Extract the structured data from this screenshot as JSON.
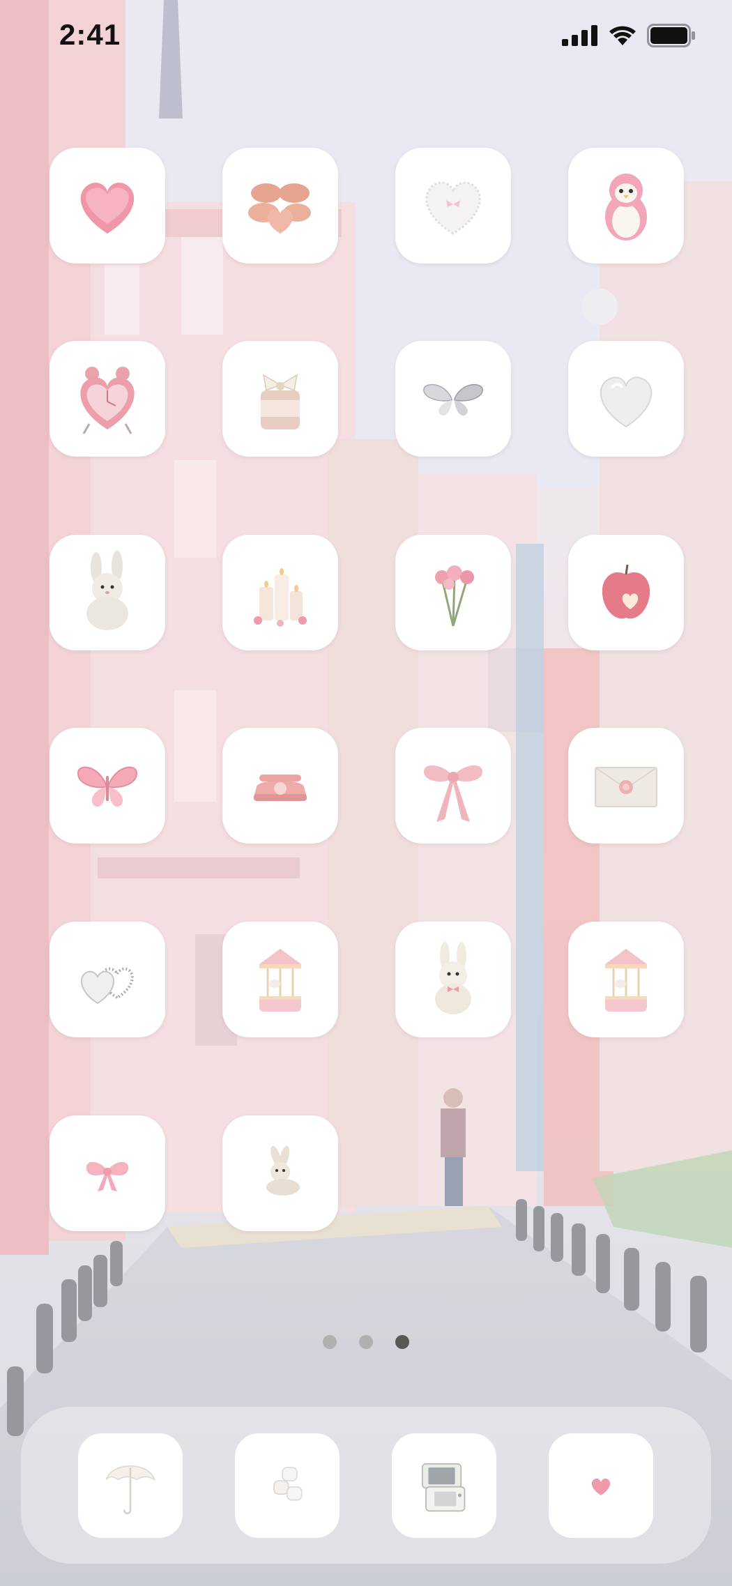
{
  "status_bar": {
    "time": "2:41",
    "icons": [
      "cellular-signal-icon",
      "wifi-icon",
      "battery-icon"
    ]
  },
  "home_screen": {
    "page_count": 3,
    "current_page": 3,
    "apps": [
      {
        "icon": "pink-heart-sponge-icon"
      },
      {
        "icon": "heart-macarons-icon"
      },
      {
        "icon": "white-lace-heart-icon"
      },
      {
        "icon": "pink-penguin-plush-icon"
      },
      {
        "icon": "heart-alarm-clock-icon"
      },
      {
        "icon": "bow-candle-jar-icon"
      },
      {
        "icon": "silver-butterfly-icon"
      },
      {
        "icon": "white-heart-icon"
      },
      {
        "icon": "bunny-plush-icon"
      },
      {
        "icon": "candles-roses-icon"
      },
      {
        "icon": "pink-roses-bouquet-icon"
      },
      {
        "icon": "apple-heart-icon"
      },
      {
        "icon": "pink-butterfly-icon"
      },
      {
        "icon": "pink-rotary-phone-icon"
      },
      {
        "icon": "pink-ribbon-bow-icon"
      },
      {
        "icon": "wax-seal-envelope-icon"
      },
      {
        "icon": "double-heart-charm-icon"
      },
      {
        "icon": "carousel-music-box-icon"
      },
      {
        "icon": "bunny-with-bow-icon"
      },
      {
        "icon": "carousel-music-box-icon"
      },
      {
        "icon": "small-pink-bow-icon"
      },
      {
        "icon": "lying-bunny-plush-icon"
      }
    ]
  },
  "dock": {
    "apps": [
      {
        "icon": "white-lace-umbrella-icon"
      },
      {
        "icon": "marshmallows-icon"
      },
      {
        "icon": "handheld-console-icon"
      },
      {
        "icon": "tiny-pink-heart-icon"
      }
    ]
  },
  "colors": {
    "accent_pink": "#f2a9b8",
    "icon_background": "#ffffff",
    "active_dot": "#555a52"
  }
}
